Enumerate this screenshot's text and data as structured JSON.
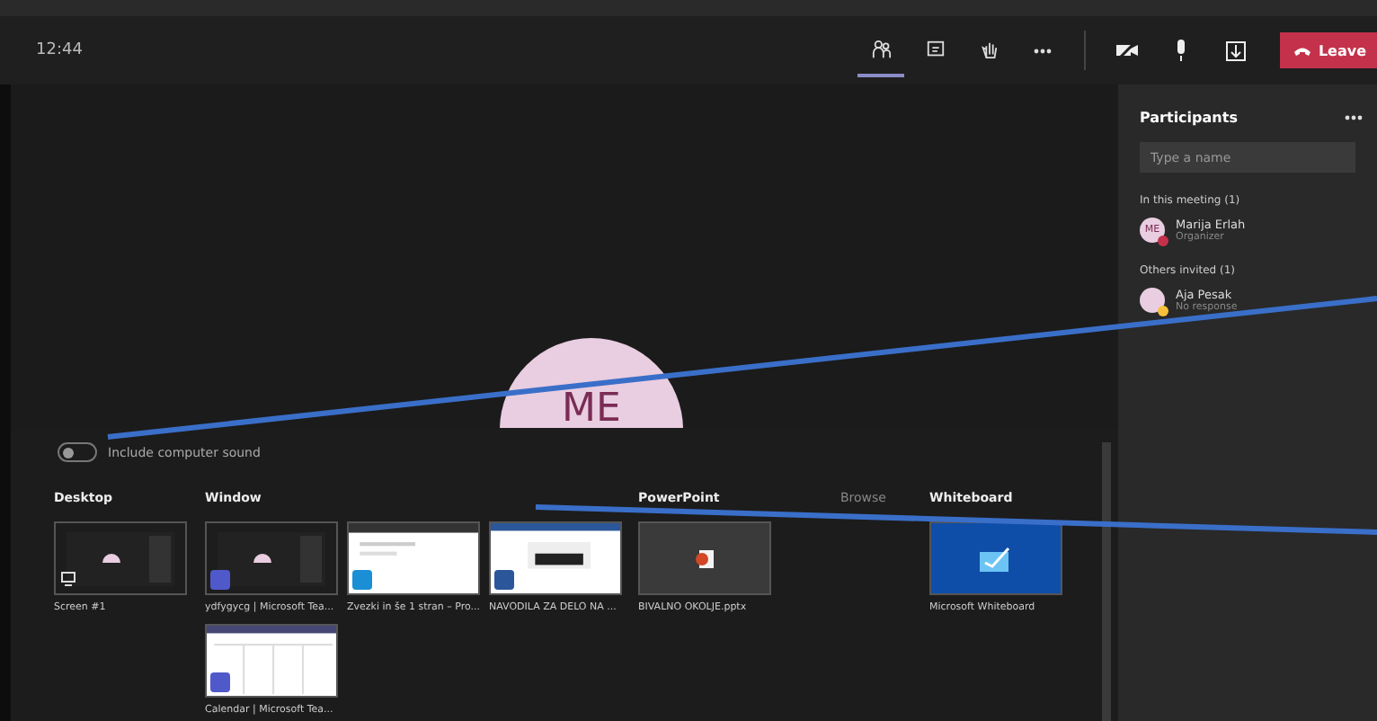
{
  "meeting_bar": {
    "time": "12:44",
    "leave_label": "Leave"
  },
  "tabs": [
    {
      "kind": "participants",
      "selected": true
    },
    {
      "kind": "chat",
      "selected": false
    },
    {
      "kind": "reactions",
      "selected": false
    }
  ],
  "stage": {
    "initials": "ME"
  },
  "participants_panel": {
    "title": "Participants",
    "search": {
      "placeholder": "Type a name"
    },
    "groups": [
      {
        "title": "In this meeting (1)",
        "people": [
          {
            "name": "Marija Erlah",
            "role": "Organizer",
            "initials": "ME",
            "color": "#c4314b"
          }
        ]
      },
      {
        "title": "Others invited (1)",
        "people": [
          {
            "name": "Aja Pesak",
            "role": "No response",
            "color": "#f8c13c"
          }
        ]
      }
    ]
  },
  "share_tray": {
    "sound_toggle": {
      "label": "Include computer sound",
      "on": false
    },
    "sections": [
      {
        "title": "Desktop",
        "items": [
          {
            "kind": "screen",
            "label": "Screen #1"
          }
        ]
      },
      {
        "title": "Window",
        "items": [
          {
            "kind": "teams",
            "label": "ydfygycg | Microsoft Tea..."
          },
          {
            "kind": "browser",
            "label": "Zvezki in še 1 stran – Pro..."
          },
          {
            "kind": "word",
            "label": "NAVODILA ZA DELO NA ..."
          },
          {
            "kind": "calendar",
            "label": "Calendar | Microsoft Tea..."
          }
        ]
      },
      {
        "title": "PowerPoint",
        "action": "Browse",
        "items": [
          {
            "kind": "powerpoint",
            "label": "BIVALNO OKOLJE.pptx"
          }
        ]
      },
      {
        "title": "Whiteboard",
        "items": [
          {
            "kind": "whiteboard",
            "label": "Microsoft Whiteboard"
          }
        ]
      }
    ]
  }
}
